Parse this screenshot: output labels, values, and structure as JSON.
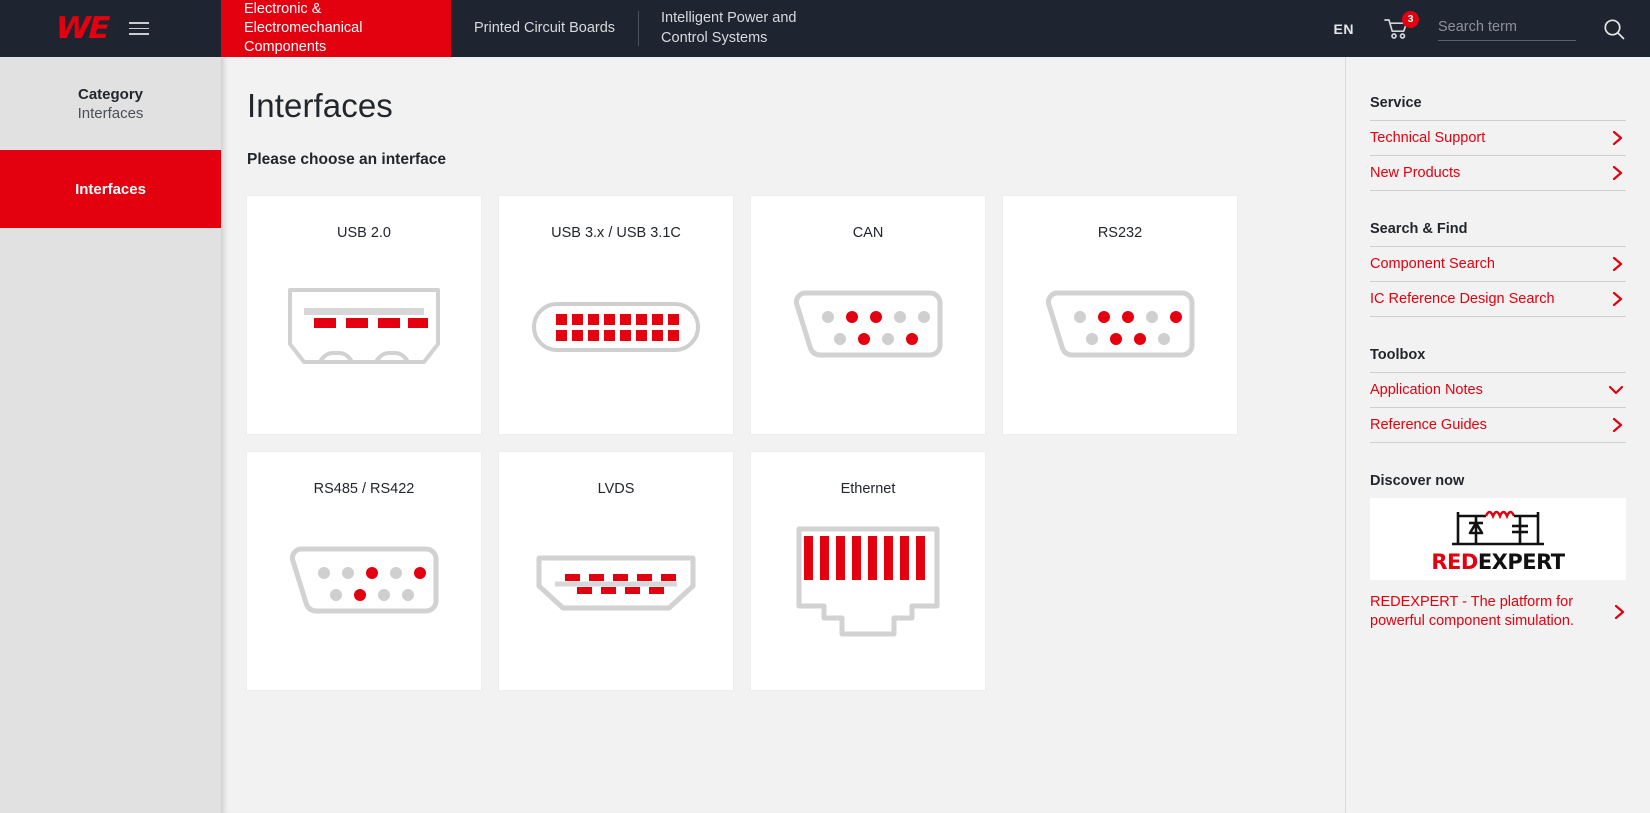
{
  "header": {
    "logo_text": "WE",
    "menu_icon": "hamburger-icon",
    "tabs": [
      {
        "label": "Electronic & Electromechanical Components",
        "active": true
      },
      {
        "label": "Printed Circuit Boards",
        "active": false
      },
      {
        "label": "Intelligent Power and Control Systems",
        "active": false
      }
    ],
    "language": "EN",
    "cart_count": "3",
    "search_placeholder": "Search term",
    "search_value": ""
  },
  "sidebar": {
    "category_label": "Category",
    "category_value": "Interfaces",
    "items": [
      {
        "label": "Interfaces",
        "active": true
      }
    ]
  },
  "main": {
    "title": "Interfaces",
    "subtitle": "Please choose an interface",
    "cards": [
      {
        "label": "USB 2.0",
        "icon": "usb-a-port-icon"
      },
      {
        "label": "USB 3.x / USB 3.1C",
        "icon": "usb-c-port-icon"
      },
      {
        "label": "CAN",
        "icon": "db9-connector-icon"
      },
      {
        "label": "RS232",
        "icon": "db9-connector-icon"
      },
      {
        "label": "RS485 / RS422",
        "icon": "db9-connector-icon"
      },
      {
        "label": "LVDS",
        "icon": "hdmi-port-icon"
      },
      {
        "label": "Ethernet",
        "icon": "rj45-port-icon"
      }
    ]
  },
  "aside": {
    "sections": [
      {
        "heading": "Service",
        "links": [
          {
            "label": "Technical Support",
            "chevron": "chevron-right-icon"
          },
          {
            "label": "New Products",
            "chevron": "chevron-right-icon"
          }
        ]
      },
      {
        "heading": "Search & Find",
        "links": [
          {
            "label": "Component Search",
            "chevron": "chevron-right-icon"
          },
          {
            "label": "IC Reference Design Search",
            "chevron": "chevron-right-icon"
          }
        ]
      },
      {
        "heading": "Toolbox",
        "links": [
          {
            "label": "Application Notes",
            "chevron": "chevron-down-icon"
          },
          {
            "label": "Reference Guides",
            "chevron": "chevron-right-icon"
          }
        ]
      }
    ],
    "discover_heading": "Discover now",
    "banner": {
      "word_red": "RED",
      "word_dark": "EXPERT",
      "icon": "buck-converter-circuit-icon"
    },
    "promo_link": "REDEXPERT - The platform for powerful component simulation."
  },
  "colors": {
    "brand_red": "#e3000f",
    "header_bg": "#1e2430",
    "page_bg": "#f2f2f2",
    "card_bg": "#ffffff",
    "pin_gray": "#cfcfcf",
    "outline_gray": "#d0d0d0"
  }
}
